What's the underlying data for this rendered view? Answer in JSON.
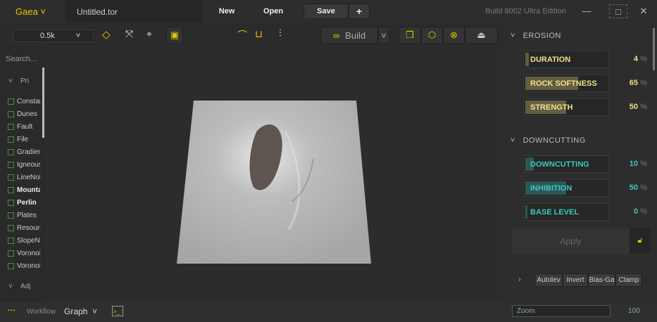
{
  "app": {
    "logo": "Gaea",
    "file_tab": "Untitled.tor",
    "new": "New",
    "open": "Open",
    "save": "Save",
    "plus": "+",
    "build_info": "Build 8002 Ultra Edition",
    "minimize": "—",
    "maximize": "□",
    "close": "✕"
  },
  "toolbar": {
    "resolution": "0.5k",
    "build": "Build"
  },
  "left": {
    "search_placeholder": "Search...",
    "group1": "Pri",
    "group2": "Adj",
    "items": [
      {
        "label": "Constant",
        "bold": false
      },
      {
        "label": "Dunes",
        "bold": false
      },
      {
        "label": "Fault",
        "bold": false
      },
      {
        "label": "File",
        "bold": false
      },
      {
        "label": "Gradient",
        "bold": false
      },
      {
        "label": "Igneous",
        "bold": false
      },
      {
        "label": "LineNoise",
        "bold": false
      },
      {
        "label": "Mountain",
        "bold": true
      },
      {
        "label": "Perlin",
        "bold": true
      },
      {
        "label": "Plates",
        "bold": false
      },
      {
        "label": "Resource",
        "bold": false
      },
      {
        "label": "SlopeNoise",
        "bold": false
      },
      {
        "label": "Voronoi",
        "bold": false
      },
      {
        "label": "Voronoi",
        "bold": false
      }
    ]
  },
  "right": {
    "erosion": {
      "title": "EROSION",
      "params": [
        {
          "label": "DURATION",
          "value": "4",
          "pct": 4
        },
        {
          "label": "ROCK SOFTNESS",
          "value": "65",
          "pct": 65
        },
        {
          "label": "STRENGTH",
          "value": "50",
          "pct": 50
        }
      ]
    },
    "downcutting": {
      "title": "DOWNCUTTING",
      "params": [
        {
          "label": "DOWNCUTTING",
          "value": "10",
          "pct": 10
        },
        {
          "label": "INHIBITION",
          "value": "50",
          "pct": 50
        },
        {
          "label": "BASE LEVEL",
          "value": "0",
          "pct": 0
        }
      ]
    },
    "unit": "%",
    "apply": "Apply",
    "buttons": [
      "Autolev",
      "Invert",
      "Bias-Ga",
      "Clamp"
    ]
  },
  "colors": {
    "erosion": "#f0e08a",
    "downcutting": "#3ec7c0",
    "accent": "#e3c800"
  },
  "bottom": {
    "dots": "···",
    "workflow": "Workflow",
    "graph": "Graph",
    "zoom_label": "Zoom",
    "zoom_value": "100"
  }
}
